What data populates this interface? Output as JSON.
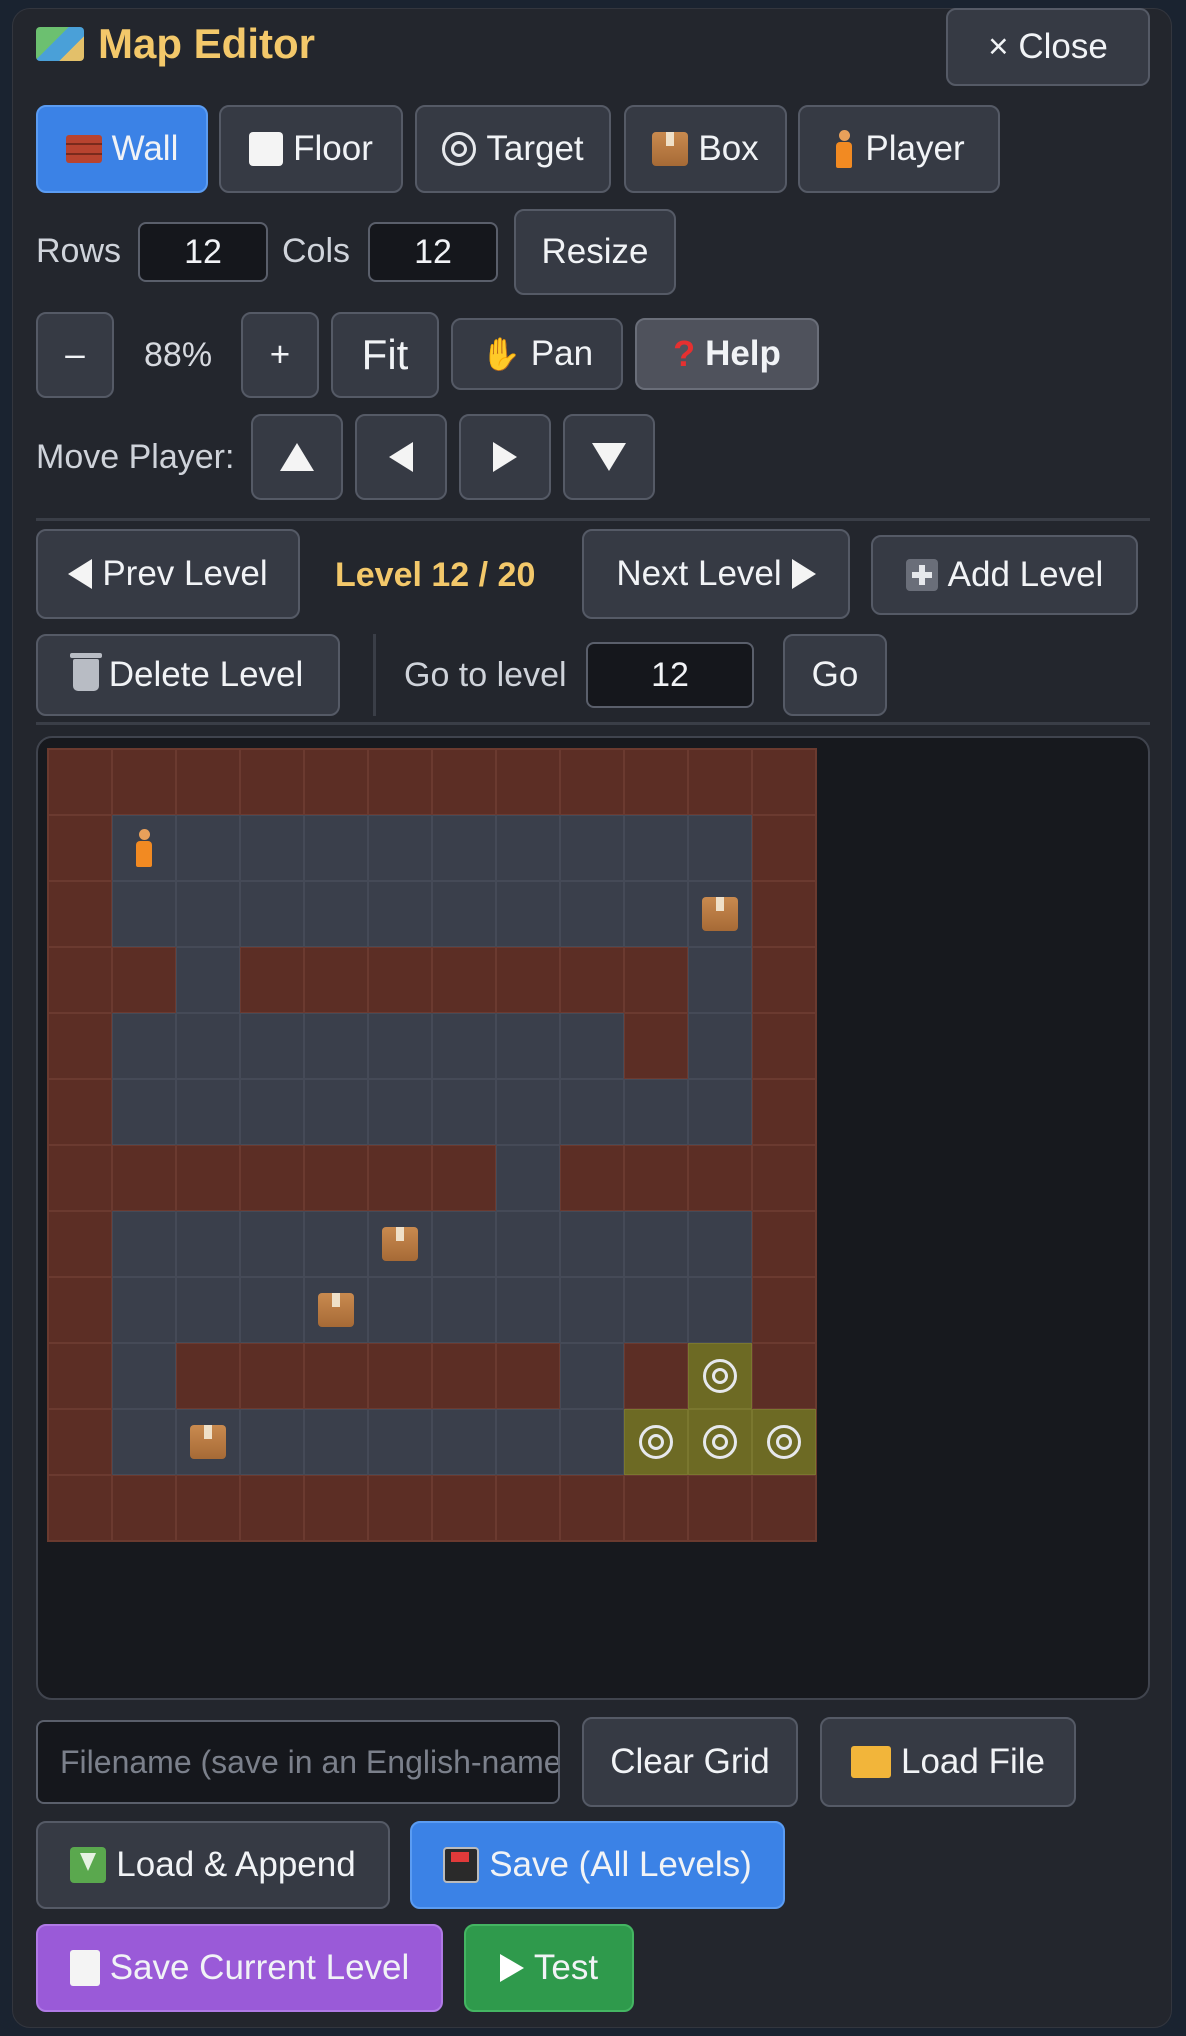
{
  "header": {
    "title": "Map Editor",
    "title_icon": "world-map-icon",
    "close_label": "× Close"
  },
  "tools": [
    {
      "id": "wall",
      "label": "Wall",
      "icon": "brick-icon",
      "active": true
    },
    {
      "id": "floor",
      "label": "Floor",
      "icon": "white-square-icon",
      "active": false
    },
    {
      "id": "target",
      "label": "Target",
      "icon": "target-icon",
      "active": false
    },
    {
      "id": "box",
      "label": "Box",
      "icon": "box-icon",
      "active": false
    },
    {
      "id": "player",
      "label": "Player",
      "icon": "player-icon",
      "active": false
    }
  ],
  "size": {
    "rows_label": "Rows",
    "rows_value": "12",
    "cols_label": "Cols",
    "cols_value": "12",
    "resize_label": "Resize"
  },
  "zoom": {
    "minus_label": "–",
    "value": "88%",
    "plus_label": "+",
    "fit_label": "Fit",
    "pan_label": "Pan",
    "help_label": "Help"
  },
  "move": {
    "label": "Move Player:"
  },
  "levels": {
    "prev_label": "Prev Level",
    "current": "Level 12 / 20",
    "next_label": "Next Level",
    "add_label": "Add Level",
    "delete_label": "Delete Level",
    "goto_label": "Go to level",
    "goto_value": "12",
    "go_label": "Go"
  },
  "grid": {
    "rows": [
      "WWWWWWWWWWWW",
      "WP.........W",
      "W.........BW",
      "WW.WWWWWWW.W",
      "W........W.W",
      "W..........W",
      "WWWWWWW.WWWW",
      "W....B.....W",
      "W...B......W",
      "W.WWWWWW.WTW",
      "W.B......TTTW"
    ],
    "legend": {
      "W": "wall",
      ".": "floor",
      "T": "target",
      "B": "box",
      "P": "player"
    }
  },
  "file": {
    "filename_placeholder": "Filename (save in an English-name)",
    "clear_label": "Clear Grid",
    "load_label": "Load File",
    "append_label": "Load & Append",
    "save_all_label": "Save (All Levels)",
    "save_current_label": "Save Current Level",
    "test_label": "Test"
  },
  "colors": {
    "accent_blue": "#3b82e6",
    "title_yellow": "#f3c86a",
    "wall": "#5c2e25",
    "floor": "#3a3f4b",
    "target": "#6d6a24"
  }
}
